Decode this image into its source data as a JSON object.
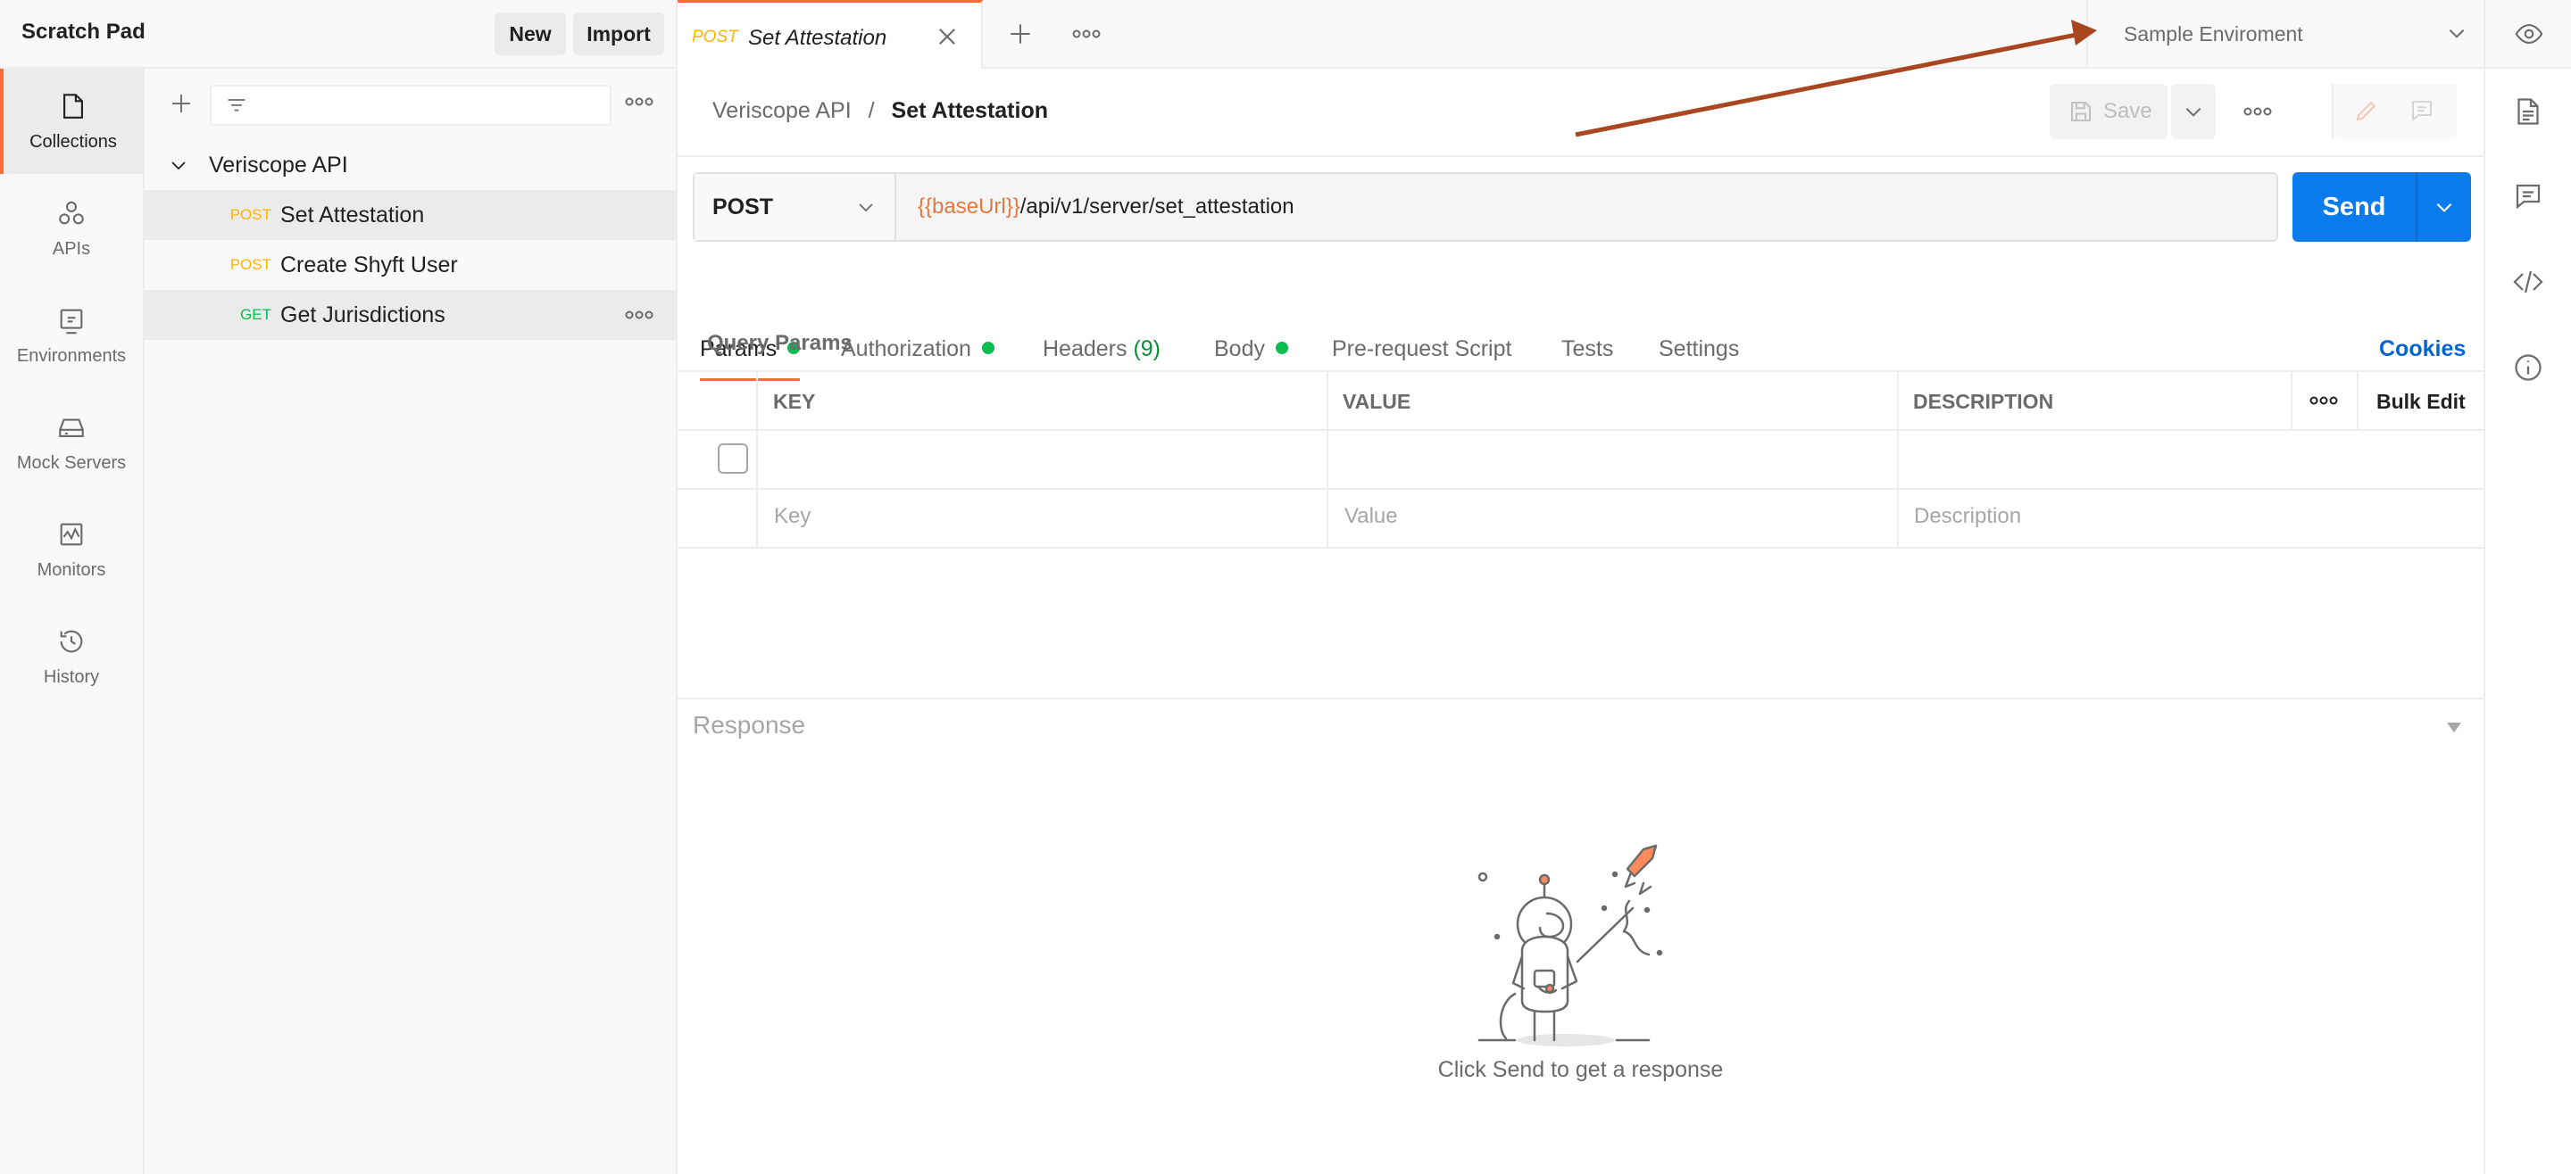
{
  "workspace": {
    "title": "Scratch Pad",
    "new_label": "New",
    "import_label": "Import"
  },
  "rail": [
    {
      "label": "Collections",
      "icon": "collections-icon",
      "active": true
    },
    {
      "label": "APIs",
      "icon": "apis-icon"
    },
    {
      "label": "Environments",
      "icon": "environments-icon"
    },
    {
      "label": "Mock Servers",
      "icon": "mock-servers-icon"
    },
    {
      "label": "Monitors",
      "icon": "monitors-icon"
    },
    {
      "label": "History",
      "icon": "history-icon"
    }
  ],
  "sidebar": {
    "collection": "Veriscope API",
    "requests": [
      {
        "method": "POST",
        "name": "Set Attestation"
      },
      {
        "method": "POST",
        "name": "Create Shyft User"
      },
      {
        "method": "GET",
        "name": "Get Jurisdictions"
      }
    ]
  },
  "tabs": {
    "active_method": "POST",
    "active_name": "Set Attestation"
  },
  "environment": {
    "selected": "Sample Enviroment"
  },
  "breadcrumb": {
    "collection": "Veriscope API",
    "separator": "/",
    "request": "Set Attestation"
  },
  "toolbar": {
    "save_label": "Save"
  },
  "request": {
    "method": "POST",
    "url_variable": "{{baseUrl}}",
    "url_path": "/api/v1/server/set_attestation",
    "send_label": "Send"
  },
  "request_tabs": {
    "params": "Params",
    "authorization": "Authorization",
    "headers": "Headers",
    "headers_count": "(9)",
    "body": "Body",
    "prerequest": "Pre-request Script",
    "tests": "Tests",
    "settings": "Settings",
    "cookies": "Cookies"
  },
  "query_params": {
    "title": "Query Params",
    "columns": {
      "key": "KEY",
      "value": "VALUE",
      "description": "DESCRIPTION"
    },
    "bulk_edit": "Bulk Edit",
    "placeholders": {
      "key": "Key",
      "value": "Value",
      "description": "Description"
    }
  },
  "response": {
    "title": "Response",
    "empty_message": "Click Send to get a response"
  },
  "colors": {
    "accent": "#ff6c37",
    "send": "#097bed",
    "get": "#0cbb52",
    "post": "#ffb400",
    "link": "#0265d2",
    "arrow": "#a8461f"
  }
}
